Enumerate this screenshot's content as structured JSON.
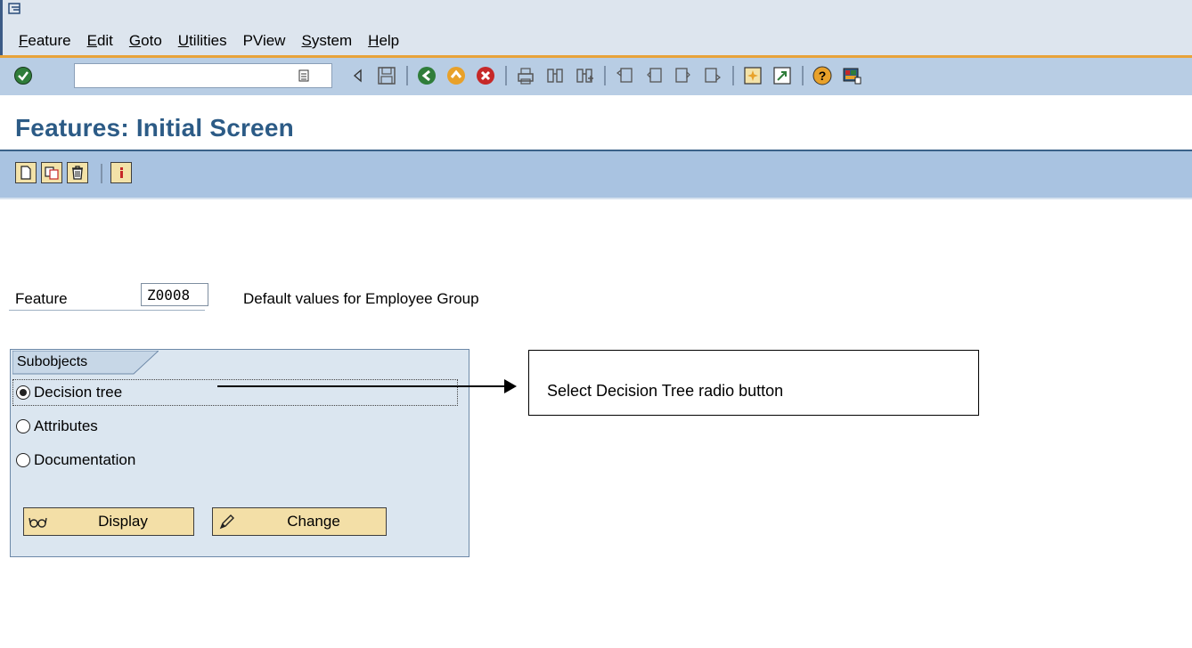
{
  "menubar": {
    "items": [
      {
        "label": "Feature",
        "mnemonic": "F",
        "rest": "eature"
      },
      {
        "label": "Edit",
        "mnemonic": "E",
        "rest": "dit"
      },
      {
        "label": "Goto",
        "mnemonic": "G",
        "rest": "oto"
      },
      {
        "label": "Utilities",
        "mnemonic": "U",
        "rest": "tilities"
      },
      {
        "label": "PView",
        "mnemonic": "",
        "rest": "PView"
      },
      {
        "label": "System",
        "mnemonic": "S",
        "rest": "ystem"
      },
      {
        "label": "Help",
        "mnemonic": "H",
        "rest": "elp"
      }
    ]
  },
  "toolbar": {
    "command_value": "",
    "icons": [
      "enter-icon",
      "dropdown-icon",
      "back-arrow-icon",
      "save-icon",
      "back-icon",
      "exit-icon",
      "cancel-icon",
      "print-icon",
      "find-icon",
      "find-next-icon",
      "first-page-icon",
      "previous-page-icon",
      "next-page-icon",
      "last-page-icon",
      "create-session-icon",
      "shortcut-icon",
      "help-icon",
      "customize-layout-icon"
    ]
  },
  "title": {
    "text": "Features: Initial Screen"
  },
  "app_toolbar": {
    "icons": [
      "create-icon",
      "copy-icon",
      "delete-icon",
      "info-icon"
    ]
  },
  "feature": {
    "label": "Feature",
    "value": "Z0008",
    "description": "Default values for Employee Group"
  },
  "subobjects": {
    "title": "Subobjects",
    "options": [
      {
        "label": "Decision tree",
        "selected": true
      },
      {
        "label": "Attributes",
        "selected": false
      },
      {
        "label": "Documentation",
        "selected": false
      }
    ],
    "display_label": "Display",
    "change_label": "Change"
  },
  "annotation": {
    "text": "Select Decision Tree radio button"
  },
  "colors": {
    "accent": "#2c5b86",
    "toolbar": "#b8cde4",
    "app_toolbar": "#a9c3e1",
    "button": "#f3dfa7",
    "orange_line": "#e8a33a"
  }
}
